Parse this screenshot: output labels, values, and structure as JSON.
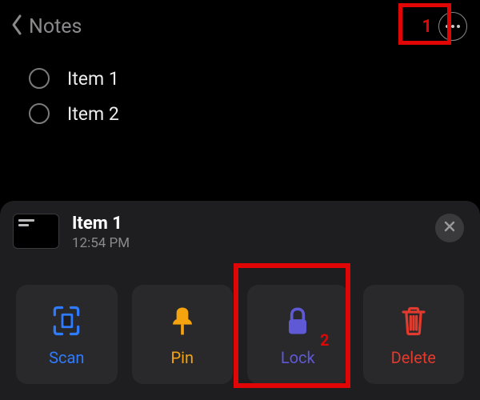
{
  "nav": {
    "back_label": "Notes"
  },
  "annotations": {
    "marker1": "1",
    "marker2": "2"
  },
  "list": {
    "items": [
      {
        "label": "Item 1"
      },
      {
        "label": "Item 2"
      }
    ]
  },
  "sheet": {
    "title": "Item 1",
    "time": "12:54 PM",
    "actions": {
      "scan": {
        "label": "Scan"
      },
      "pin": {
        "label": "Pin"
      },
      "lock": {
        "label": "Lock"
      },
      "delete": {
        "label": "Delete"
      }
    }
  }
}
